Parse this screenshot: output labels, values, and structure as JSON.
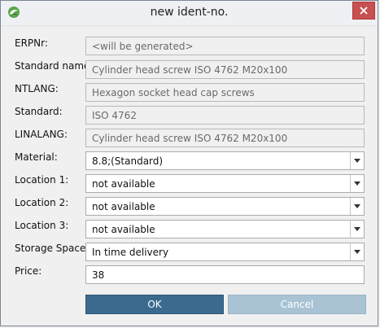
{
  "window": {
    "title": "new ident-no.",
    "icon": "app-logo-icon",
    "close_icon": "close-icon"
  },
  "form": {
    "erpnr": {
      "label": "ERPNr:",
      "value": "<will be generated>"
    },
    "standard_name": {
      "label": "Standard name:",
      "value": "Cylinder head screw ISO 4762 M20x100"
    },
    "ntlang": {
      "label": "NTLANG:",
      "value": "Hexagon socket head cap screws"
    },
    "standard": {
      "label": "Standard:",
      "value": "ISO 4762"
    },
    "linalang": {
      "label": "LINALANG:",
      "value": "Cylinder head screw ISO 4762 M20x100"
    },
    "material": {
      "label": "Material:",
      "value": "8.8;(Standard)"
    },
    "location1": {
      "label": "Location 1:",
      "value": "not available"
    },
    "location2": {
      "label": "Location 2:",
      "value": "not available"
    },
    "location3": {
      "label": "Location 3:",
      "value": "not available"
    },
    "storage_space": {
      "label": "Storage Space:",
      "value": "In time delivery"
    },
    "price": {
      "label": "Price:",
      "value": "38"
    }
  },
  "buttons": {
    "ok": "OK",
    "cancel": "Cancel"
  },
  "colors": {
    "ok_bg": "#3b6a8e",
    "cancel_bg": "#a9c3d4",
    "close_bg": "#c75050"
  }
}
